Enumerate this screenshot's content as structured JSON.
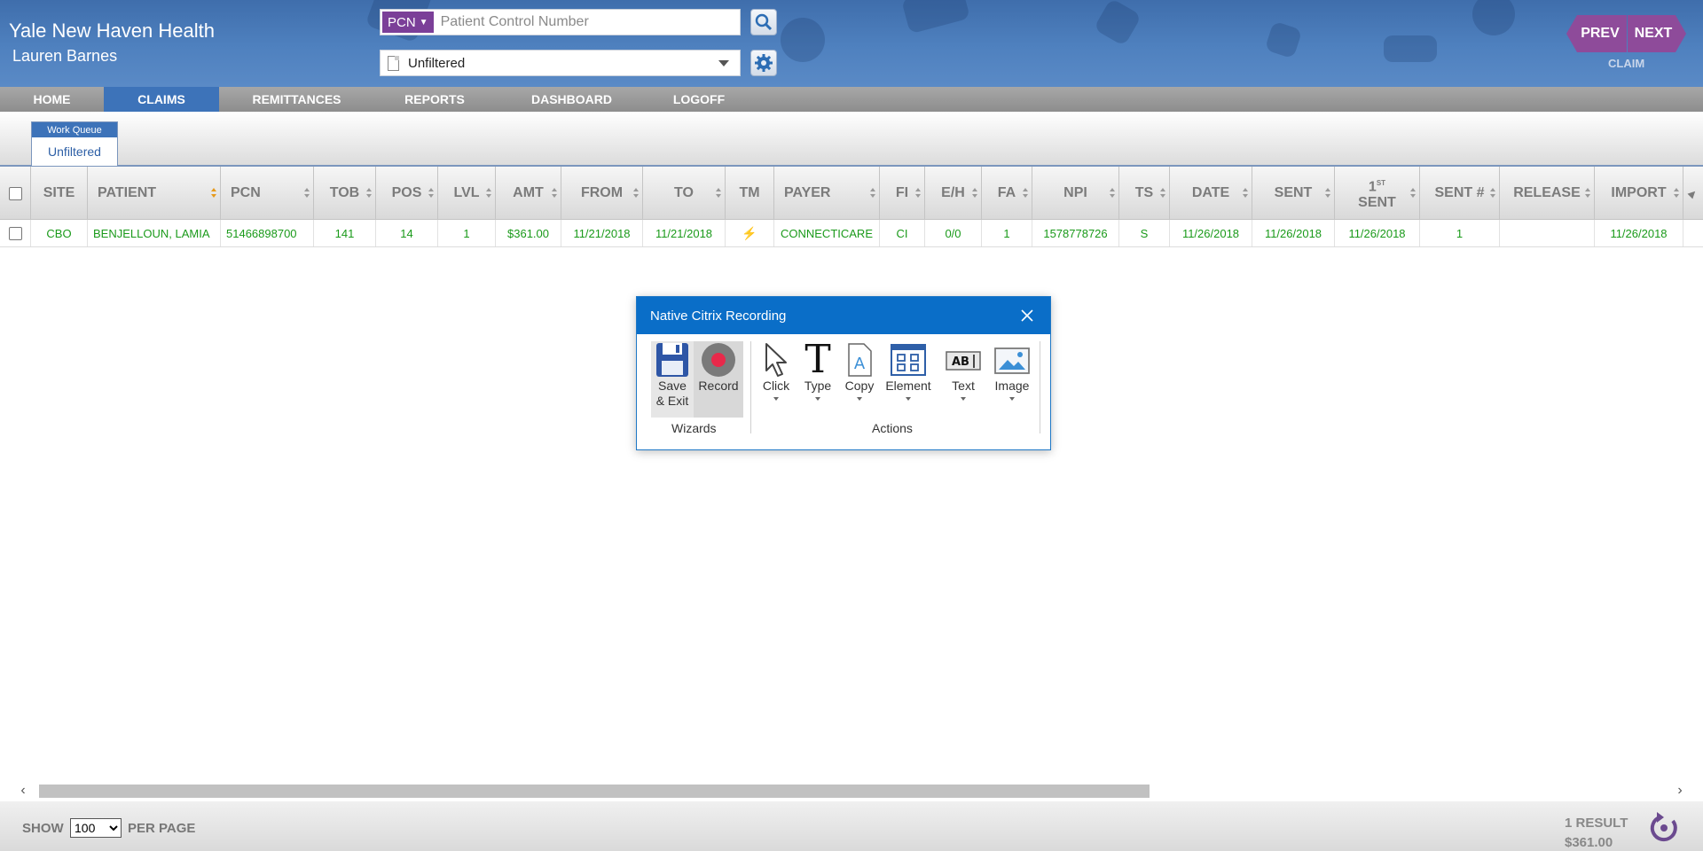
{
  "header": {
    "org_name": "Yale New Haven Health",
    "user_name": "Lauren Barnes",
    "search": {
      "type": "PCN",
      "placeholder": "Patient Control Number",
      "value": ""
    },
    "filter": {
      "selected": "Unfiltered"
    },
    "prev_label": "PREV",
    "next_label": "NEXT",
    "nav_context": "CLAIM",
    "accent_purple": "#8e4b9a",
    "accent_blue": "#3d73b9"
  },
  "menu": {
    "items": [
      {
        "label": "HOME",
        "active": false
      },
      {
        "label": "CLAIMS",
        "active": true
      },
      {
        "label": "REMITTANCES",
        "active": false
      },
      {
        "label": "REPORTS",
        "active": false
      },
      {
        "label": "DASHBOARD",
        "active": false
      },
      {
        "label": "LOGOFF",
        "active": false
      }
    ]
  },
  "work_queue": {
    "label": "Work Queue",
    "value": "Unfiltered"
  },
  "table": {
    "columns": [
      "SITE",
      "PATIENT",
      "PCN",
      "TOB",
      "POS",
      "LVL",
      "AMT",
      "FROM",
      "TO",
      "TM",
      "PAYER",
      "FI",
      "E/H",
      "FA",
      "NPI",
      "TS",
      "DATE",
      "SENT",
      "1ST SENT",
      "SENT #",
      "RELEASE",
      "IMPORT"
    ],
    "first_sent": {
      "sup": "ST",
      "num": "1",
      "word": "SENT"
    },
    "rows": [
      {
        "site": "CBO",
        "patient": "BENJELLOUN, LAMIA",
        "pcn": "51466898700",
        "tob": "141",
        "pos": "14",
        "lvl": "1",
        "amt": "$361.00",
        "from": "11/21/2018",
        "to": "11/21/2018",
        "tm": "⚡",
        "payer": "CONNECTICARE",
        "fi": "CI",
        "eh": "0/0",
        "fa": "1",
        "npi": "1578778726",
        "ts": "S",
        "date": "11/26/2018",
        "sent": "11/26/2018",
        "first_sent": "11/26/2018",
        "sent_count": "1",
        "release": "",
        "import": "11/26/2018"
      }
    ],
    "row_text_color": "#1a9a1a"
  },
  "dialog": {
    "title": "Native Citrix Recording",
    "tools": {
      "save_exit": "Save\n& Exit",
      "record": "Record",
      "click": "Click",
      "type": "Type",
      "copy": "Copy",
      "element": "Element",
      "text": "Text",
      "image": "Image"
    },
    "groups": {
      "wizards": "Wizards",
      "actions": "Actions"
    }
  },
  "footer": {
    "show": "SHOW",
    "per_page_value": "100",
    "per_page_options": [
      "100"
    ],
    "per_page": "PER PAGE",
    "result_count": "1 RESULT",
    "result_total": "$361.00"
  }
}
